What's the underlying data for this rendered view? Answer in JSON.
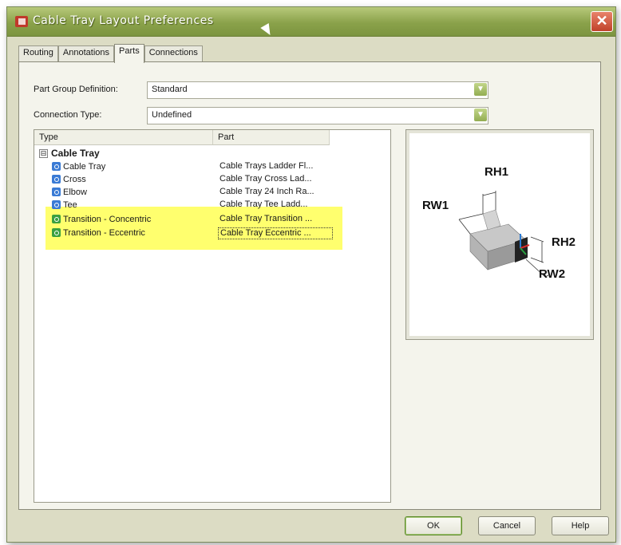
{
  "window": {
    "title": "Cable Tray Layout Preferences",
    "close_glyph": "✕"
  },
  "tabs": [
    {
      "label": "Routing",
      "active": false
    },
    {
      "label": "Annotations",
      "active": false
    },
    {
      "label": "Parts",
      "active": true
    },
    {
      "label": "Connections",
      "active": false
    }
  ],
  "fields": {
    "part_group_label": "Part Group Definition:",
    "part_group_value": "Standard",
    "connection_type_label": "Connection Type:",
    "connection_type_value": "Undefined"
  },
  "table": {
    "columns": [
      "Type",
      "Part"
    ],
    "group": {
      "expander": "⊟",
      "label": "Cable Tray"
    },
    "rows": [
      {
        "type": "Cable Tray",
        "part": "Cable Trays Ladder Fl...",
        "highlighted": false
      },
      {
        "type": "Cross",
        "part": "Cable Tray Cross Lad...",
        "highlighted": false
      },
      {
        "type": "Elbow",
        "part": "Cable Tray 24 Inch Ra...",
        "highlighted": false
      },
      {
        "type": "Tee",
        "part": "Cable Tray Tee  Ladd...",
        "highlighted": false
      },
      {
        "type": "Transition - Concentric",
        "part": "Cable Tray Transition ...",
        "highlighted": true
      },
      {
        "type": "Transition - Eccentric",
        "part": "Cable Tray Eccentric ...",
        "highlighted": true
      }
    ]
  },
  "preview": {
    "labels": [
      "RH1",
      "RW1",
      "RH2",
      "RW2"
    ]
  },
  "buttons": {
    "ok": "OK",
    "cancel": "Cancel",
    "help": "Help"
  },
  "colors": {
    "highlight": "#ffff6e",
    "titlebar": "#8aa24a"
  }
}
